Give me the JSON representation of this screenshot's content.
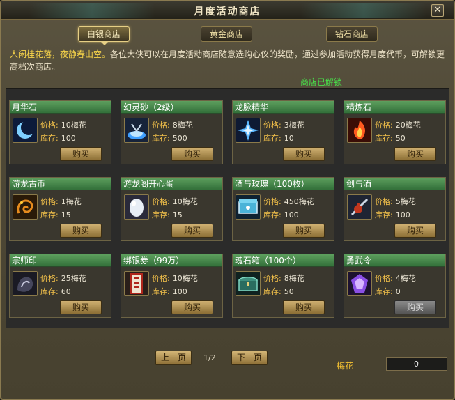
{
  "window": {
    "title": "月度活动商店"
  },
  "tabs": [
    {
      "label": "白银商店",
      "active": true
    },
    {
      "label": "黄金商店",
      "active": false
    },
    {
      "label": "钻石商店",
      "active": false
    }
  ],
  "description": {
    "highlight": "人闲桂花落，夜静春山空。",
    "text": "各位大侠可以在月度活动商店随意选购心仪的奖励，通过参加活动获得月度代币，可解锁更高档次商店。"
  },
  "unlocked_text": "商店已解锁",
  "labels": {
    "price": "价格:",
    "stock": "库存:",
    "buy": "购买"
  },
  "items": [
    {
      "name": "月华石",
      "price": "10梅花",
      "stock": "100",
      "icon": "crescent-moon-icon",
      "buy_enabled": true
    },
    {
      "name": "幻灵砂（2级）",
      "price": "8梅花",
      "stock": "500",
      "icon": "spirit-sand-icon",
      "buy_enabled": true
    },
    {
      "name": "龙脉精华",
      "price": "3梅花",
      "stock": "10",
      "icon": "blue-crystal-icon",
      "buy_enabled": true
    },
    {
      "name": "精炼石",
      "price": "20梅花",
      "stock": "50",
      "icon": "fire-stone-icon",
      "buy_enabled": true
    },
    {
      "name": "游龙古币",
      "price": "1梅花",
      "stock": "15",
      "icon": "dragon-coin-icon",
      "buy_enabled": true
    },
    {
      "name": "游龙阁开心蛋",
      "price": "10梅花",
      "stock": "15",
      "icon": "egg-icon",
      "buy_enabled": true
    },
    {
      "name": "酒与玫瑰（100枚）",
      "price": "450梅花",
      "stock": "100",
      "icon": "chest-box-icon",
      "buy_enabled": true
    },
    {
      "name": "剑与酒",
      "price": "5梅花",
      "stock": "100",
      "icon": "sword-wine-icon",
      "buy_enabled": true
    },
    {
      "name": "宗师印",
      "price": "25梅花",
      "stock": "60",
      "icon": "master-seal-icon",
      "buy_enabled": true
    },
    {
      "name": "绑银券（99万）",
      "price": "10梅花",
      "stock": "100",
      "icon": "silver-voucher-icon",
      "buy_enabled": true
    },
    {
      "name": "魂石箱（100个）",
      "price": "8梅花",
      "stock": "50",
      "icon": "soul-chest-icon",
      "buy_enabled": true
    },
    {
      "name": "勇武令",
      "price": "4梅花",
      "stock": "0",
      "icon": "purple-token-icon",
      "buy_enabled": false
    }
  ],
  "pager": {
    "prev": "上一页",
    "next": "下一页",
    "info": "1/2"
  },
  "currency": {
    "label": "梅花",
    "value": "0"
  }
}
